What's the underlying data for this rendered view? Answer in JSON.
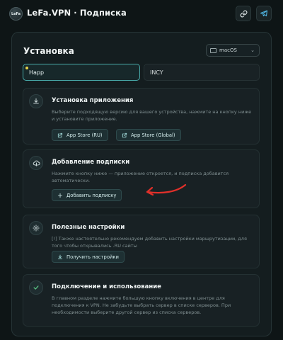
{
  "header": {
    "logo_text": "LeFa",
    "title": "LeFa.VPN · Подписка",
    "link_icon": "link-icon",
    "telegram_icon": "telegram-icon"
  },
  "panel": {
    "title": "Установка",
    "os_select": {
      "value": "macOS",
      "icon": "monitor-icon"
    },
    "tabs": [
      {
        "label": "Happ",
        "active": true
      },
      {
        "label": "INCY",
        "active": false
      }
    ]
  },
  "steps": [
    {
      "icon": "download-icon",
      "title": "Установка приложения",
      "description": "Выберите подходящую версию для вашего устройства, нажмите на кнопку ниже и установите приложение.",
      "buttons": [
        {
          "label": "App Store (RU)",
          "icon": "external-link-icon"
        },
        {
          "label": "App Store (Global)",
          "icon": "external-link-icon"
        }
      ]
    },
    {
      "icon": "cloud-download-icon",
      "title": "Добавление подписки",
      "description": "Нажмите кнопку ниже — приложение откроется, и подписка добавится автоматически.",
      "buttons": [
        {
          "label": "Добавить подписку",
          "icon": "plus-icon"
        }
      ]
    },
    {
      "icon": "gear-icon",
      "title": "Полезные настройки",
      "description": "[!] Также настоятельно рекомендуем добавить настройки маршрутизации, для того чтобы открывались .RU сайты",
      "buttons": [
        {
          "label": "Получить настройки",
          "icon": "download-icon"
        }
      ]
    },
    {
      "icon": "check-circle-icon",
      "title": "Подключение и использование",
      "description": "В главном разделе нажмите большую кнопку включения в центре для подключения к VPN. Не забудьте выбрать сервер в списке серверов. При необходимости выберите другой сервер из списка серверов.",
      "buttons": []
    }
  ],
  "colors": {
    "background": "#0e1516",
    "accent": "#48a9a8",
    "annotation_arrow": "#e0302a"
  }
}
